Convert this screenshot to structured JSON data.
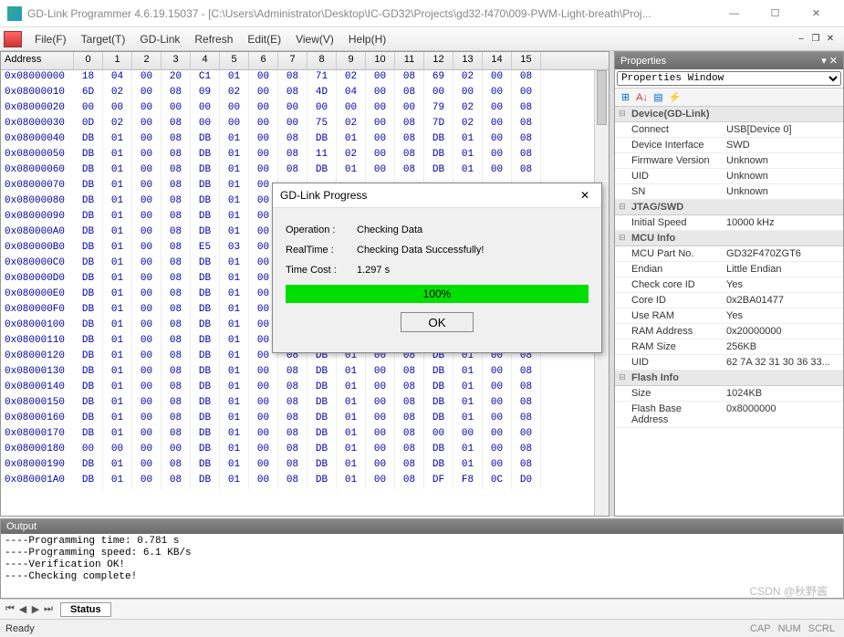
{
  "window": {
    "title": "GD-Link Programmer 4.6.19.15037 - [C:\\Users\\Administrator\\Desktop\\IC-GD32\\Projects\\gd32-f470\\009-PWM-Light-breath\\Proj..."
  },
  "menu": {
    "file": "File(F)",
    "target": "Target(T)",
    "gdlink": "GD-Link",
    "refresh": "Refresh",
    "edit": "Edit(E)",
    "view": "View(V)",
    "help": "Help(H)"
  },
  "hex": {
    "address_header": "Address",
    "cols": [
      "0",
      "1",
      "2",
      "3",
      "4",
      "5",
      "6",
      "7",
      "8",
      "9",
      "10",
      "11",
      "12",
      "13",
      "14",
      "15"
    ],
    "rows": [
      {
        "addr": "0x08000000",
        "b": [
          "18",
          "04",
          "00",
          "20",
          "C1",
          "01",
          "00",
          "08",
          "71",
          "02",
          "00",
          "08",
          "69",
          "02",
          "00",
          "08"
        ]
      },
      {
        "addr": "0x08000010",
        "b": [
          "6D",
          "02",
          "00",
          "08",
          "09",
          "02",
          "00",
          "08",
          "4D",
          "04",
          "00",
          "08",
          "00",
          "00",
          "00",
          "00"
        ]
      },
      {
        "addr": "0x08000020",
        "b": [
          "00",
          "00",
          "00",
          "00",
          "00",
          "00",
          "00",
          "00",
          "00",
          "00",
          "00",
          "00",
          "79",
          "02",
          "00",
          "08"
        ]
      },
      {
        "addr": "0x08000030",
        "b": [
          "0D",
          "02",
          "00",
          "08",
          "00",
          "00",
          "00",
          "00",
          "75",
          "02",
          "00",
          "08",
          "7D",
          "02",
          "00",
          "08"
        ]
      },
      {
        "addr": "0x08000040",
        "b": [
          "DB",
          "01",
          "00",
          "08",
          "DB",
          "01",
          "00",
          "08",
          "DB",
          "01",
          "00",
          "08",
          "DB",
          "01",
          "00",
          "08"
        ]
      },
      {
        "addr": "0x08000050",
        "b": [
          "DB",
          "01",
          "00",
          "08",
          "DB",
          "01",
          "00",
          "08",
          "11",
          "02",
          "00",
          "08",
          "DB",
          "01",
          "00",
          "08"
        ]
      },
      {
        "addr": "0x08000060",
        "b": [
          "DB",
          "01",
          "00",
          "08",
          "DB",
          "01",
          "00",
          "08",
          "DB",
          "01",
          "00",
          "08",
          "DB",
          "01",
          "00",
          "08"
        ]
      },
      {
        "addr": "0x08000070",
        "b": [
          "DB",
          "01",
          "00",
          "08",
          "DB",
          "01",
          "00",
          "",
          "",
          "",
          "",
          "",
          "",
          "",
          "",
          "",
          ""
        ]
      },
      {
        "addr": "0x08000080",
        "b": [
          "DB",
          "01",
          "00",
          "08",
          "DB",
          "01",
          "00",
          "",
          "",
          "",
          "",
          "",
          "",
          "",
          "",
          "",
          ""
        ]
      },
      {
        "addr": "0x08000090",
        "b": [
          "DB",
          "01",
          "00",
          "08",
          "DB",
          "01",
          "00",
          "",
          "",
          "",
          "",
          "",
          "",
          "",
          "",
          "",
          ""
        ]
      },
      {
        "addr": "0x080000A0",
        "b": [
          "DB",
          "01",
          "00",
          "08",
          "DB",
          "01",
          "00",
          "",
          "",
          "",
          "",
          "",
          "",
          "",
          "",
          "",
          ""
        ]
      },
      {
        "addr": "0x080000B0",
        "b": [
          "DB",
          "01",
          "00",
          "08",
          "E5",
          "03",
          "00",
          "",
          "",
          "",
          "",
          "",
          "",
          "",
          "",
          "",
          ""
        ]
      },
      {
        "addr": "0x080000C0",
        "b": [
          "DB",
          "01",
          "00",
          "08",
          "DB",
          "01",
          "00",
          "",
          "",
          "",
          "",
          "",
          "",
          "",
          "",
          "",
          ""
        ]
      },
      {
        "addr": "0x080000D0",
        "b": [
          "DB",
          "01",
          "00",
          "08",
          "DB",
          "01",
          "00",
          "",
          "",
          "",
          "",
          "",
          "",
          "",
          "",
          "",
          ""
        ]
      },
      {
        "addr": "0x080000E0",
        "b": [
          "DB",
          "01",
          "00",
          "08",
          "DB",
          "01",
          "00",
          "",
          "",
          "",
          "",
          "",
          "",
          "",
          "",
          "",
          ""
        ]
      },
      {
        "addr": "0x080000F0",
        "b": [
          "DB",
          "01",
          "00",
          "08",
          "DB",
          "01",
          "00",
          "",
          "",
          "",
          "",
          "",
          "",
          "",
          "",
          "",
          ""
        ]
      },
      {
        "addr": "0x08000100",
        "b": [
          "DB",
          "01",
          "00",
          "08",
          "DB",
          "01",
          "00",
          "",
          "",
          "",
          "",
          "",
          "",
          "",
          "",
          "",
          ""
        ]
      },
      {
        "addr": "0x08000110",
        "b": [
          "DB",
          "01",
          "00",
          "08",
          "DB",
          "01",
          "00",
          "",
          "",
          "",
          "",
          "",
          "",
          "",
          "",
          "",
          ""
        ]
      },
      {
        "addr": "0x08000120",
        "b": [
          "DB",
          "01",
          "00",
          "08",
          "DB",
          "01",
          "00",
          "08",
          "DB",
          "01",
          "00",
          "08",
          "DB",
          "01",
          "00",
          "08"
        ]
      },
      {
        "addr": "0x08000130",
        "b": [
          "DB",
          "01",
          "00",
          "08",
          "DB",
          "01",
          "00",
          "08",
          "DB",
          "01",
          "00",
          "08",
          "DB",
          "01",
          "00",
          "08"
        ]
      },
      {
        "addr": "0x08000140",
        "b": [
          "DB",
          "01",
          "00",
          "08",
          "DB",
          "01",
          "00",
          "08",
          "DB",
          "01",
          "00",
          "08",
          "DB",
          "01",
          "00",
          "08"
        ]
      },
      {
        "addr": "0x08000150",
        "b": [
          "DB",
          "01",
          "00",
          "08",
          "DB",
          "01",
          "00",
          "08",
          "DB",
          "01",
          "00",
          "08",
          "DB",
          "01",
          "00",
          "08"
        ]
      },
      {
        "addr": "0x08000160",
        "b": [
          "DB",
          "01",
          "00",
          "08",
          "DB",
          "01",
          "00",
          "08",
          "DB",
          "01",
          "00",
          "08",
          "DB",
          "01",
          "00",
          "08"
        ]
      },
      {
        "addr": "0x08000170",
        "b": [
          "DB",
          "01",
          "00",
          "08",
          "DB",
          "01",
          "00",
          "08",
          "DB",
          "01",
          "00",
          "08",
          "00",
          "00",
          "00",
          "00"
        ]
      },
      {
        "addr": "0x08000180",
        "b": [
          "00",
          "00",
          "00",
          "00",
          "DB",
          "01",
          "00",
          "08",
          "DB",
          "01",
          "00",
          "08",
          "DB",
          "01",
          "00",
          "08"
        ]
      },
      {
        "addr": "0x08000190",
        "b": [
          "DB",
          "01",
          "00",
          "08",
          "DB",
          "01",
          "00",
          "08",
          "DB",
          "01",
          "00",
          "08",
          "DB",
          "01",
          "00",
          "08"
        ]
      },
      {
        "addr": "0x080001A0",
        "b": [
          "DB",
          "01",
          "00",
          "08",
          "DB",
          "01",
          "00",
          "08",
          "DB",
          "01",
          "00",
          "08",
          "DF",
          "F8",
          "0C",
          "D0"
        ]
      }
    ]
  },
  "properties": {
    "header": "Properties",
    "dropdown": "Properties Window",
    "groups": [
      {
        "name": "Device(GD-Link)",
        "items": [
          {
            "k": "Connect",
            "v": "USB[Device 0]"
          },
          {
            "k": "Device Interface",
            "v": "SWD"
          },
          {
            "k": "Firmware Version",
            "v": "Unknown"
          },
          {
            "k": "UID",
            "v": "Unknown"
          },
          {
            "k": "SN",
            "v": "Unknown"
          }
        ]
      },
      {
        "name": "JTAG/SWD",
        "items": [
          {
            "k": "Initial Speed",
            "v": "10000 kHz"
          }
        ]
      },
      {
        "name": "MCU Info",
        "items": [
          {
            "k": "MCU Part No.",
            "v": "GD32F470ZGT6"
          },
          {
            "k": "Endian",
            "v": "Little Endian"
          },
          {
            "k": "Check core ID",
            "v": "Yes"
          },
          {
            "k": "Core ID",
            "v": "0x2BA01477"
          },
          {
            "k": "Use RAM",
            "v": "Yes"
          },
          {
            "k": "RAM Address",
            "v": "0x20000000"
          },
          {
            "k": "RAM Size",
            "v": "256KB"
          },
          {
            "k": "UID",
            "v": "62 7A 32 31 30 36 33..."
          }
        ]
      },
      {
        "name": "Flash Info",
        "items": [
          {
            "k": "Size",
            "v": "1024KB"
          },
          {
            "k": "Flash Base Address",
            "v": "0x8000000"
          }
        ]
      }
    ]
  },
  "output": {
    "header": "Output",
    "lines": "----Programming time: 0.781 s\n----Programming speed: 6.1 KB/s\n----Verification OK!\n----Checking complete!"
  },
  "tabs": {
    "status": "Status"
  },
  "statusbar": {
    "ready": "Ready",
    "cap": "CAP",
    "num": "NUM",
    "scrl": "SCRL"
  },
  "dialog": {
    "title": "GD-Link Progress",
    "op_k": "Operation :",
    "op_v": "Checking Data",
    "rt_k": "RealTime :",
    "rt_v": "Checking Data Successfully!",
    "tc_k": "Time Cost :",
    "tc_v": "1.297 s",
    "progress": "100%",
    "ok": "OK"
  },
  "watermark": "CSDN @秋野酱"
}
